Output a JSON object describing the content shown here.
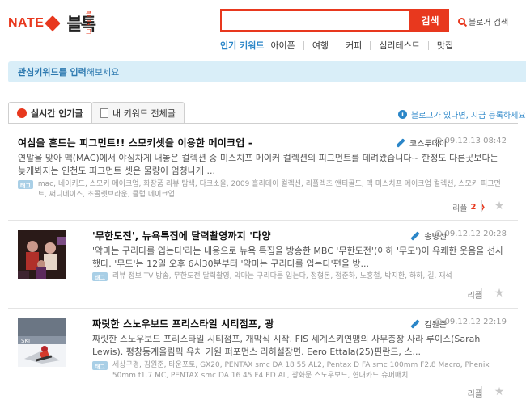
{
  "header": {
    "logo_text": "NATE",
    "service_name": "블톡",
    "service_name_small": "블로그",
    "search_placeholder": "",
    "search_button": "검색",
    "blog_search_link": "블로거 검색"
  },
  "hot_keywords": {
    "label": "인기 키워드",
    "items": [
      "아이폰",
      "여행",
      "커피",
      "심리테스트",
      "맛집"
    ]
  },
  "interest_bar": {
    "bold": "관심키워드를 입력",
    "rest": "해보세요"
  },
  "tabs": [
    {
      "label": "실시간 인기글",
      "active": true
    },
    {
      "label": "내 키워드 전체글",
      "active": false
    }
  ],
  "register_note": "블로그가 있다면, 지금 등록하세요",
  "posts": [
    {
      "title": "여심을 흔드는 피그먼트!! 스모키셋을 이용한 메이크업 -",
      "author": "코스투데이",
      "time": "09.12.13 08:42",
      "summary": "연말을 맞아 맥(MAC)에서 야심차게 내놓은 컬렉션 중 미스치프 메이커 컬렉션의 피그먼트를 데려왔습니다~ 한정도 다른곳보다는 늦게봐지는 인천도 피그먼트 셋은 물량이 엄청나게 ...",
      "tag_badge": "태그",
      "tags": "mac, 네이키드, 스모키 메이크업, 화장품 리뷰 탐색, 다크소울, 2009 홀리데이 컬렉션, 리플렉츠 앤티골드, 맥 미스치프 메이크업 컬렉션, 스모키 피그먼트, 써니데이즈, 초콜렛브라운, 클럽 메이크업",
      "reply_label": "리플",
      "reply_count": "2"
    },
    {
      "title": "'무한도전', 뉴욕특집에 달력촬영까지 '다양",
      "author": "송병선",
      "time": "09.12.12 20:28",
      "summary": "'악마는 구리다를 입는다'라는 내용으로 뉴욕 특집을 방송한 MBC '무한도전'(이하 '무도')이 유쾌한 웃음을 선사했다. '무도'는 12일 오후 6시30분부터 '악마는 구리다를 입는다'편을 방...",
      "tag_badge": "태그",
      "tags": "리뷰 정보 TV 방송, 무한도전 달력촬영, 악마는 구리다를 입는다, 정형돈, 정준하, 노홍철, 박지환, 하하, 길, 재석",
      "reply_label": "리플",
      "reply_count": ""
    },
    {
      "title": "짜릿한 스노우보드 프리스타일 시티점프, 광",
      "author": "김원준",
      "time": "09.12.12 22:19",
      "summary": "짜릿한 스노우보드 프리스타일 시티점프, 개막식 시작. FIS 세계스키연맹의 사무총장 사라 루이스(Sarah Lewis). 평창동계올림픽 유치 기원 퍼포먼스 리허설장면. Eero Ettala(25)핀란드, 스...",
      "tag_badge": "태그",
      "tags": "세상구경, 김원준, 타운포토, GX20, PENTAX smc DA 18 55 AL2, Pentax D FA smc 100mm F2.8 Macro, Phenix 50mm f1.7 MC, PENTAX smc DA 16 45 F4 ED AL, 광화문 스노우보드, 현대카드 슈퍼매치",
      "reply_label": "리플",
      "reply_count": ""
    }
  ],
  "colors": {
    "accent": "#e8381e",
    "link_blue": "#2b86c8",
    "interest_bg": "#d9eef8"
  }
}
